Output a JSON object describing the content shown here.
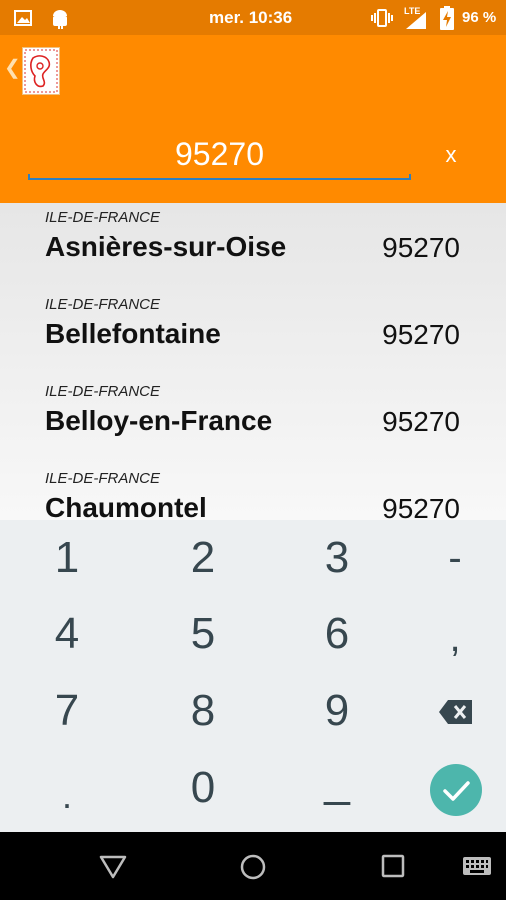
{
  "status_bar": {
    "time": "mer. 10:36",
    "network": "LTE",
    "battery_percent": "96 %"
  },
  "app_bar": {
    "search_value": "95270",
    "clear_label": "x"
  },
  "results": [
    {
      "region": "ILE-DE-FRANCE",
      "city": "Asnières-sur-Oise",
      "zip": "95270"
    },
    {
      "region": "ILE-DE-FRANCE",
      "city": "Bellefontaine",
      "zip": "95270"
    },
    {
      "region": "ILE-DE-FRANCE",
      "city": "Belloy-en-France",
      "zip": "95270"
    },
    {
      "region": "ILE-DE-FRANCE",
      "city": "Chaumontel",
      "zip": "95270"
    }
  ],
  "keyboard": {
    "keys": [
      "1",
      "2",
      "3",
      "-",
      "4",
      "5",
      "6",
      ",",
      "7",
      "8",
      "9",
      ".",
      "0",
      "_"
    ],
    "icons": {
      "backspace": "backspace-icon",
      "done": "check-icon"
    }
  },
  "colors": {
    "status_bar": "#e57b00",
    "app_bar": "#ff8a00",
    "accent": "#4db6ac",
    "underline": "#2c7fc1"
  }
}
